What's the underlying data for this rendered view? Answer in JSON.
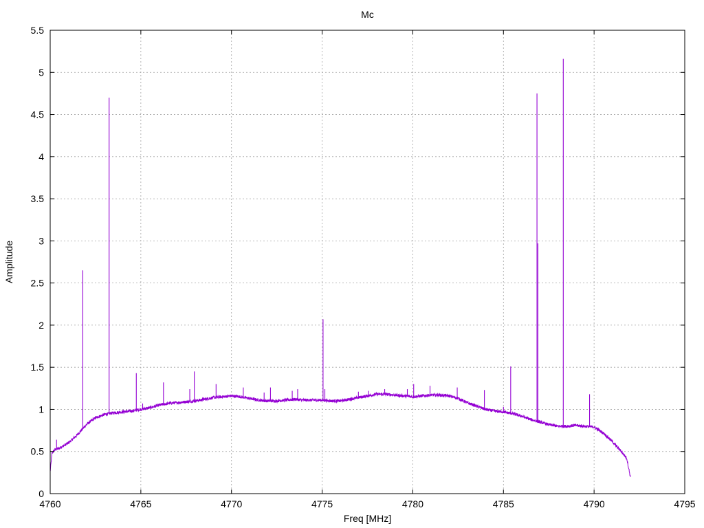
{
  "chart_data": {
    "type": "line",
    "title": "Mc",
    "xlabel": "Freq [MHz]",
    "ylabel": "Amplitude",
    "xlim": [
      4760,
      4795
    ],
    "ylim": [
      0,
      5.5
    ],
    "xticks": [
      4760,
      4765,
      4770,
      4775,
      4780,
      4785,
      4790,
      4795
    ],
    "yticks": [
      0,
      0.5,
      1,
      1.5,
      2,
      2.5,
      3,
      3.5,
      4,
      4.5,
      5,
      5.5
    ],
    "grid": true,
    "color": "#9400d3",
    "series": [
      {
        "baseline": [
          [
            4760.0,
            0.26
          ],
          [
            4760.1,
            0.48
          ],
          [
            4760.25,
            0.52
          ],
          [
            4760.5,
            0.54
          ],
          [
            4761.0,
            0.6
          ],
          [
            4761.5,
            0.7
          ],
          [
            4762.0,
            0.82
          ],
          [
            4762.5,
            0.9
          ],
          [
            4763.0,
            0.94
          ],
          [
            4763.5,
            0.96
          ],
          [
            4764.0,
            0.97
          ],
          [
            4764.5,
            0.98
          ],
          [
            4765.0,
            1.0
          ],
          [
            4765.5,
            1.02
          ],
          [
            4766.0,
            1.05
          ],
          [
            4766.5,
            1.07
          ],
          [
            4767.0,
            1.08
          ],
          [
            4767.5,
            1.09
          ],
          [
            4768.0,
            1.1
          ],
          [
            4768.5,
            1.12
          ],
          [
            4769.0,
            1.14
          ],
          [
            4769.5,
            1.15
          ],
          [
            4770.0,
            1.16
          ],
          [
            4770.5,
            1.15
          ],
          [
            4771.0,
            1.13
          ],
          [
            4771.5,
            1.11
          ],
          [
            4772.0,
            1.1
          ],
          [
            4772.5,
            1.1
          ],
          [
            4773.0,
            1.11
          ],
          [
            4773.5,
            1.12
          ],
          [
            4774.0,
            1.11
          ],
          [
            4774.5,
            1.11
          ],
          [
            4775.0,
            1.11
          ],
          [
            4775.5,
            1.1
          ],
          [
            4776.0,
            1.1
          ],
          [
            4776.5,
            1.12
          ],
          [
            4777.0,
            1.14
          ],
          [
            4777.5,
            1.16
          ],
          [
            4778.0,
            1.18
          ],
          [
            4778.5,
            1.18
          ],
          [
            4779.0,
            1.17
          ],
          [
            4779.5,
            1.16
          ],
          [
            4780.0,
            1.15
          ],
          [
            4780.5,
            1.16
          ],
          [
            4781.0,
            1.17
          ],
          [
            4781.5,
            1.17
          ],
          [
            4782.0,
            1.16
          ],
          [
            4782.5,
            1.13
          ],
          [
            4783.0,
            1.08
          ],
          [
            4783.5,
            1.04
          ],
          [
            4784.0,
            1.0
          ],
          [
            4784.5,
            0.98
          ],
          [
            4785.0,
            0.97
          ],
          [
            4785.5,
            0.95
          ],
          [
            4786.0,
            0.92
          ],
          [
            4786.5,
            0.88
          ],
          [
            4787.0,
            0.85
          ],
          [
            4787.5,
            0.82
          ],
          [
            4788.0,
            0.8
          ],
          [
            4788.5,
            0.8
          ],
          [
            4789.0,
            0.81
          ],
          [
            4789.5,
            0.8
          ],
          [
            4790.0,
            0.79
          ],
          [
            4790.5,
            0.72
          ],
          [
            4791.0,
            0.62
          ],
          [
            4791.5,
            0.5
          ],
          [
            4791.8,
            0.42
          ],
          [
            4792.0,
            0.2
          ]
        ],
        "spikes": [
          [
            4760.35,
            0.64
          ],
          [
            4761.8,
            2.65
          ],
          [
            4763.25,
            4.7
          ],
          [
            4764.75,
            1.43
          ],
          [
            4765.1,
            1.07
          ],
          [
            4766.25,
            1.32
          ],
          [
            4767.7,
            1.24
          ],
          [
            4767.95,
            1.45
          ],
          [
            4769.15,
            1.3
          ],
          [
            4770.65,
            1.26
          ],
          [
            4771.8,
            1.2
          ],
          [
            4772.15,
            1.26
          ],
          [
            4773.35,
            1.22
          ],
          [
            4773.65,
            1.24
          ],
          [
            4775.05,
            2.07
          ],
          [
            4775.15,
            1.24
          ],
          [
            4777.0,
            1.21
          ],
          [
            4777.55,
            1.22
          ],
          [
            4778.45,
            1.24
          ],
          [
            4779.7,
            1.24
          ],
          [
            4780.05,
            1.3
          ],
          [
            4780.95,
            1.28
          ],
          [
            4782.45,
            1.26
          ],
          [
            4783.95,
            1.23
          ],
          [
            4785.0,
            1.03
          ],
          [
            4785.4,
            1.51
          ],
          [
            4786.85,
            4.75
          ],
          [
            4786.9,
            2.97
          ],
          [
            4788.3,
            5.16
          ],
          [
            4789.75,
            1.18
          ],
          [
            4791.2,
            0.55
          ]
        ]
      }
    ]
  }
}
